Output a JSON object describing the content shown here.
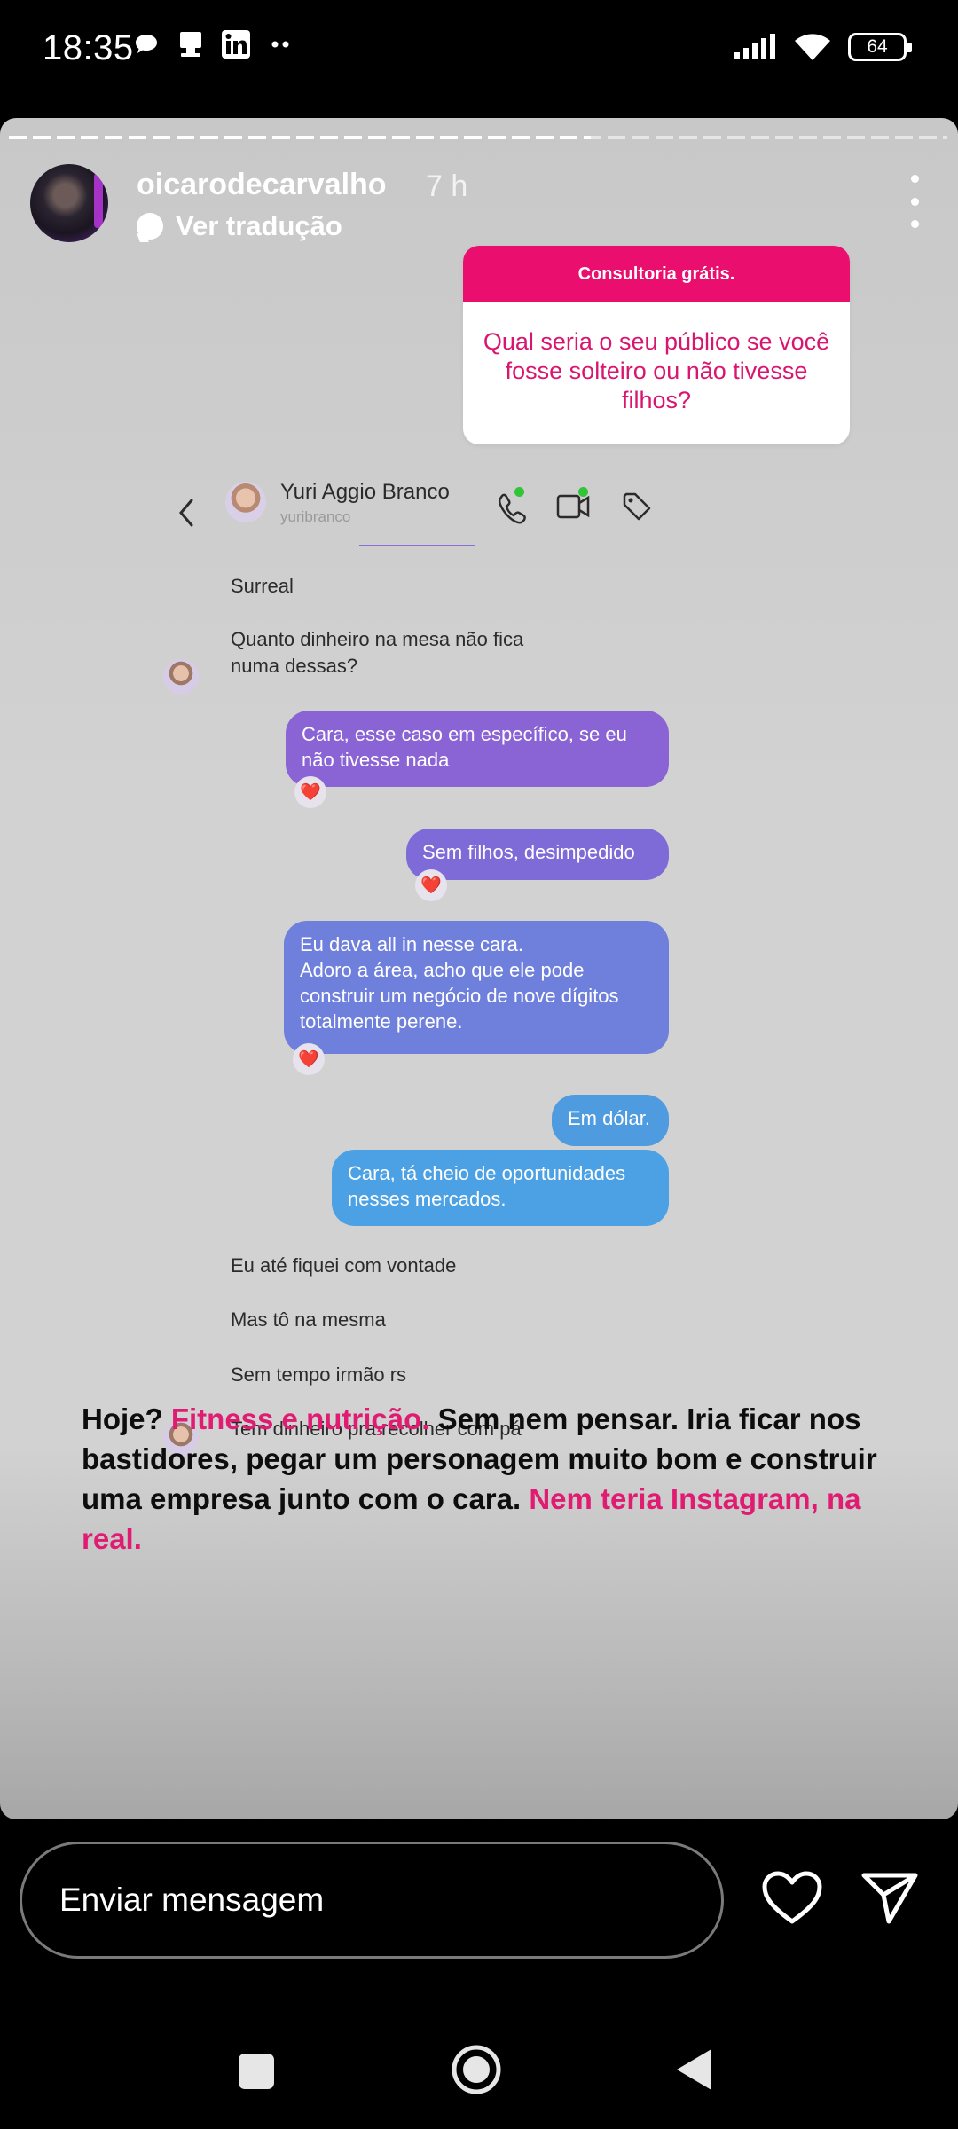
{
  "status": {
    "time": "18:35",
    "battery": "64",
    "left_icons": [
      "chat-bubble-icon",
      "media-icon",
      "linkedin-icon",
      "more-dots-icon"
    ],
    "right_icons": [
      "signal-icon",
      "wifi-icon",
      "battery-icon"
    ]
  },
  "story": {
    "progress": 0.62,
    "username": "oicarodecarvalho",
    "time_ago": "7 h",
    "translate_label": "Ver tradução"
  },
  "question_sticker": {
    "header": "Consultoria grátis.",
    "question": "Qual seria o seu público se você fosse solteiro ou não tivesse filhos?",
    "colors": {
      "header": "#ea0f6e",
      "text": "#d9166f"
    }
  },
  "chat": {
    "contact_name": "Yuri Aggio Branco",
    "contact_handle": "yuribranco",
    "incoming_1": "Surreal",
    "incoming_2": "Quanto dinheiro na mesa não fica numa dessas?",
    "outgoing_1": "Cara, esse caso em específico, se eu não tivesse nada",
    "outgoing_2": "Sem filhos, desimpedido",
    "outgoing_3": "Eu dava all in nesse cara.\nAdoro a área, acho que ele pode construir um negócio de nove dígitos totalmente perene.",
    "outgoing_4": "Em dólar.",
    "outgoing_5": "Cara, tá cheio de oportunidades nesses mercados.",
    "incoming_3": "Eu até fiquei com vontade",
    "incoming_4": "Mas tô na mesma",
    "incoming_5": "Sem tempo irmão rs",
    "incoming_6": "Tem dinheiro pra recolher com pá",
    "reaction": "❤️"
  },
  "caption": {
    "p1": "Hoje? ",
    "p2": "Fitness e nutrição.",
    "p3": " Sem nem pensar. Iria ficar nos bastidores, pegar um personagem muito bom e construir uma empresa junto com o cara. ",
    "p4": "Nem teria Instagram, na real."
  },
  "reply": {
    "placeholder": "Enviar mensagem"
  }
}
